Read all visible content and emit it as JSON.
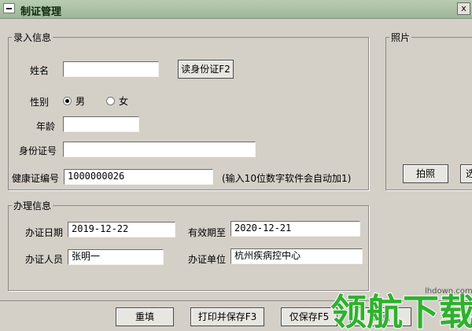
{
  "window": {
    "title": "制证管理",
    "close_glyph": "x"
  },
  "entry": {
    "legend": "录入信息",
    "name_label": "姓名",
    "name_value": "",
    "read_id_button": "读身份证F2",
    "gender_label": "性别",
    "gender_options": [
      "男",
      "女"
    ],
    "gender_selected": "男",
    "age_label": "年龄",
    "age_value": "",
    "id_label": "身份证号",
    "id_value": "",
    "cert_label": "健康证编号",
    "cert_value": "1000000026",
    "cert_hint": "(输入10位数字软件会自动加1)"
  },
  "photo": {
    "legend": "照片",
    "capture_button": "拍照",
    "second_button_partial": "选"
  },
  "process": {
    "legend": "办理信息",
    "issue_date_label": "办证日期",
    "issue_date_value": "2019-12-22",
    "valid_until_label": "有效期至",
    "valid_until_value": "2020-12-21",
    "operator_label": "办证人员",
    "operator_value": "张明一",
    "unit_label": "办证单位",
    "unit_value": "杭州疾病控中心"
  },
  "actions": {
    "reset_button": "重填",
    "print_save_button": "打印并保存F3",
    "save_only_button": "仅保存F5",
    "return_button_partial": "返回"
  },
  "watermark": {
    "text": "领航下载",
    "url": "lhdown.com",
    "color": "#2fb12f"
  }
}
